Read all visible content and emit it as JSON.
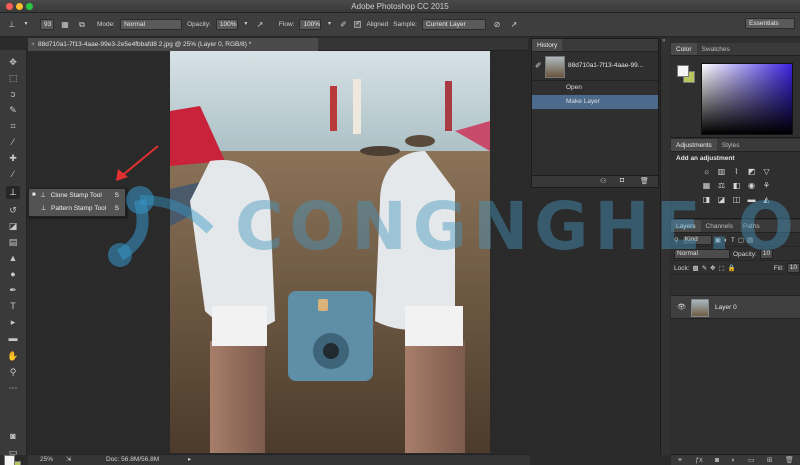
{
  "window": {
    "title": "Adobe Photoshop CC 2015",
    "traffic_colors": [
      "#fc5f57",
      "#fdbc2e",
      "#28c840"
    ]
  },
  "options_bar": {
    "brush_size": "93",
    "mode_label": "Mode:",
    "mode_value": "Normal",
    "opacity_label": "Opacity:",
    "opacity_value": "100%",
    "flow_label": "Flow:",
    "flow_value": "100%",
    "aligned_label": "Aligned",
    "aligned_checked": true,
    "sample_label": "Sample:",
    "sample_value": "Current Layer",
    "workspace": "Essentials"
  },
  "document": {
    "tab_label": "88d710a1-7f13-4aae-99e3-2e5e4fbbafd8 2.jpg @ 25% (Layer 0, RGB/8) *",
    "zoom": "25%",
    "doc_size": "Doc: 56.8M/56.8M"
  },
  "tool_flyout": {
    "items": [
      {
        "label": "Clone Stamp Tool",
        "key": "S"
      },
      {
        "label": "Pattern Stamp Tool",
        "key": "S"
      }
    ]
  },
  "history_panel": {
    "tab": "History",
    "snapshot_label": "88d710a1-7f13-4aae-99...",
    "states": [
      {
        "label": "Open"
      },
      {
        "label": "Make Layer"
      }
    ]
  },
  "color_panel": {
    "tabs": [
      "Color",
      "Swatches"
    ],
    "fg": "#f5f5f5",
    "bg": "#b8c45e"
  },
  "adjustments_panel": {
    "tabs": [
      "Adjustments",
      "Styles"
    ],
    "heading": "Add an adjustment"
  },
  "layers_panel": {
    "tabs": [
      "Layers",
      "Channels",
      "Paths"
    ],
    "filter_kind": "Kind",
    "blend_mode": "Normal",
    "opacity_label": "Opacity:",
    "opacity_value": "10",
    "lock_label": "Lock:",
    "fill_label": "Fill:",
    "fill_value": "10",
    "layers": [
      {
        "name": "Layer 0"
      }
    ]
  },
  "watermark": {
    "text": "CONGNGHE.ORG"
  }
}
